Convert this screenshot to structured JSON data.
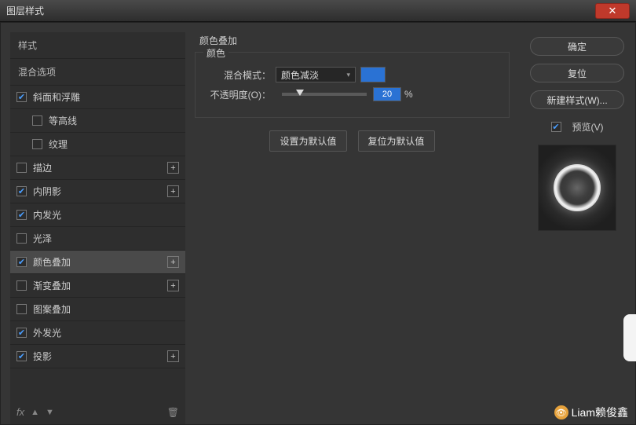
{
  "window": {
    "title": "图层样式",
    "close": "✕"
  },
  "left": {
    "styles_header": "样式",
    "blend_header": "混合选项",
    "items": [
      {
        "label": "斜面和浮雕",
        "checked": true,
        "plus": false
      },
      {
        "label": "等高线",
        "checked": false,
        "plus": false,
        "indent": true
      },
      {
        "label": "纹理",
        "checked": false,
        "plus": false,
        "indent": true
      },
      {
        "label": "描边",
        "checked": false,
        "plus": true
      },
      {
        "label": "内阴影",
        "checked": true,
        "plus": true
      },
      {
        "label": "内发光",
        "checked": true,
        "plus": false
      },
      {
        "label": "光泽",
        "checked": false,
        "plus": false
      },
      {
        "label": "颜色叠加",
        "checked": true,
        "plus": true,
        "selected": true
      },
      {
        "label": "渐变叠加",
        "checked": false,
        "plus": true
      },
      {
        "label": "图案叠加",
        "checked": false,
        "plus": false
      },
      {
        "label": "外发光",
        "checked": true,
        "plus": false
      },
      {
        "label": "投影",
        "checked": true,
        "plus": true
      }
    ],
    "footer_fx": "fx"
  },
  "center": {
    "group_title": "颜色叠加",
    "fieldset_label": "颜色",
    "blend_label": "混合模式：",
    "blend_value": "颜色减淡",
    "opacity_label": "不透明度(O)：",
    "opacity_value": "20",
    "opacity_unit": "%",
    "color_swatch": "#2a72d4",
    "btn_default": "设置为默认值",
    "btn_reset": "复位为默认值"
  },
  "right": {
    "ok": "确定",
    "cancel": "复位",
    "new_style": "新建样式(W)...",
    "preview_label": "预览(V)"
  },
  "watermark": "Liam赖俊鑫"
}
